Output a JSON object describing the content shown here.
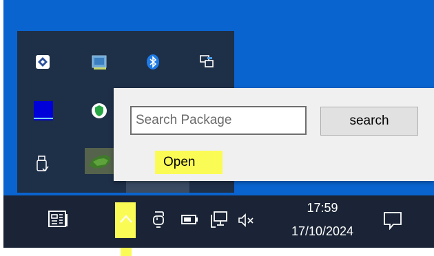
{
  "popup": {
    "search_placeholder": "Search Package",
    "search_button": "search",
    "open_item": "Open"
  },
  "tray_overflow": {
    "icons": [
      "app-diamond-icon",
      "monitor-app-icon",
      "bluetooth-icon",
      "remote-display-icon",
      "blue-display-icon",
      "shield-security-icon",
      "usb-eject-icon",
      "green-map-icon"
    ]
  },
  "taskbar": {
    "icons": [
      "news-widget-icon",
      "chevron-up-icon",
      "touchpad-icon",
      "battery-icon",
      "network-icon",
      "speaker-muted-icon",
      "notification-icon"
    ],
    "clock": {
      "time": "17:59",
      "date": "17/10/2024"
    }
  },
  "colors": {
    "desktop": "#0a64cf",
    "tray_panel": "#1e2f48",
    "taskbar": "#1a2436",
    "highlight": "#fbfb56"
  }
}
